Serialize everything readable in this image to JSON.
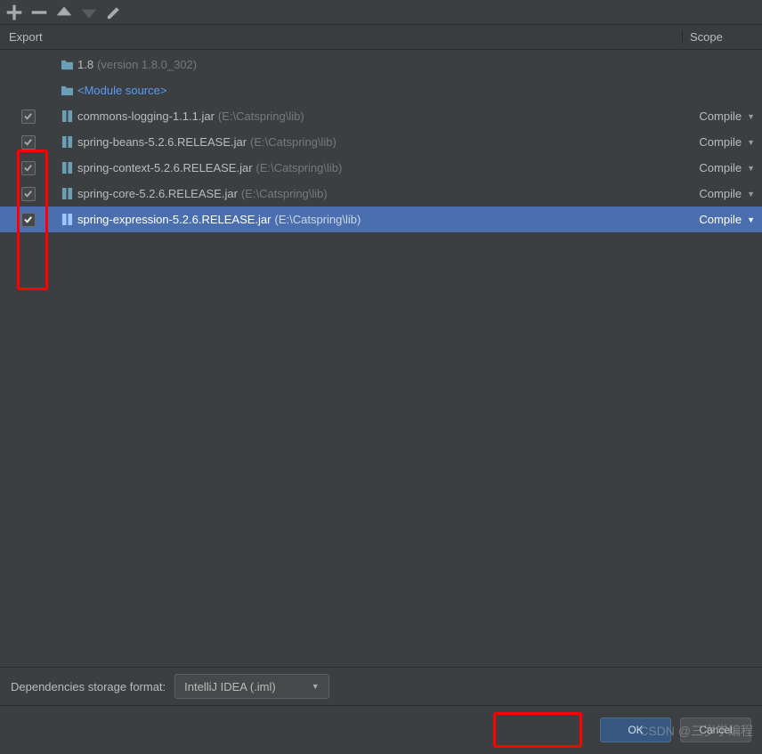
{
  "toolbar": {
    "add": "+",
    "remove": "−",
    "up": "▲",
    "down": "▼",
    "edit": "edit"
  },
  "columns": {
    "export": "Export",
    "scope": "Scope"
  },
  "jdk": {
    "name": "1.8",
    "version": "(version 1.8.0_302)"
  },
  "module_source": "<Module source>",
  "deps": [
    {
      "checked": true,
      "name": "commons-logging-1.1.1.jar",
      "path": "(E:\\Catspring\\lib)",
      "scope": "Compile",
      "selected": false
    },
    {
      "checked": true,
      "name": "spring-beans-5.2.6.RELEASE.jar",
      "path": "(E:\\Catspring\\lib)",
      "scope": "Compile",
      "selected": false
    },
    {
      "checked": true,
      "name": "spring-context-5.2.6.RELEASE.jar",
      "path": "(E:\\Catspring\\lib)",
      "scope": "Compile",
      "selected": false
    },
    {
      "checked": true,
      "name": "spring-core-5.2.6.RELEASE.jar",
      "path": "(E:\\Catspring\\lib)",
      "scope": "Compile",
      "selected": false
    },
    {
      "checked": true,
      "name": "spring-expression-5.2.6.RELEASE.jar",
      "path": "(E:\\Catspring\\lib)",
      "scope": "Compile",
      "selected": true
    }
  ],
  "storage": {
    "label": "Dependencies storage format:",
    "value": "IntelliJ IDEA (.iml)"
  },
  "buttons": {
    "ok": "OK",
    "cancel": "Cancel"
  },
  "watermark": "CSDN @三岁学编程"
}
